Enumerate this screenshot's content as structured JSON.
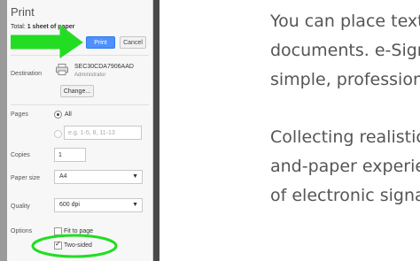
{
  "print_panel": {
    "title": "Print",
    "total_label": "Total:",
    "total_value": "1 sheet of paper",
    "print_button": "Print",
    "cancel_button": "Cancel",
    "destination": {
      "label": "Destination",
      "printer_name": "SEC30CDA7906AAD",
      "printer_owner": "Administrator",
      "change_button": "Change..."
    },
    "pages": {
      "label": "Pages",
      "all_option": "All",
      "range_placeholder": "e.g. 1-5, 8, 11-13"
    },
    "copies": {
      "label": "Copies",
      "value": "1"
    },
    "paper_size": {
      "label": "Paper size",
      "value": "A4"
    },
    "quality": {
      "label": "Quality",
      "value": "600 dpi"
    },
    "options": {
      "label": "Options",
      "fit_to_page": "Fit to page",
      "two_sided": "Two-sided",
      "fit_to_page_checked": false,
      "two_sided_checked": true
    }
  },
  "annotations": {
    "color": "#22dd22",
    "arrow_icon": "arrow-right-icon",
    "highlight": "ellipse"
  },
  "document": {
    "lines": [
      "You can place text",
      "documents. e-Sign",
      "simple, profession",
      "Collecting realistic",
      "and-paper experie",
      "of electronic signat"
    ]
  }
}
